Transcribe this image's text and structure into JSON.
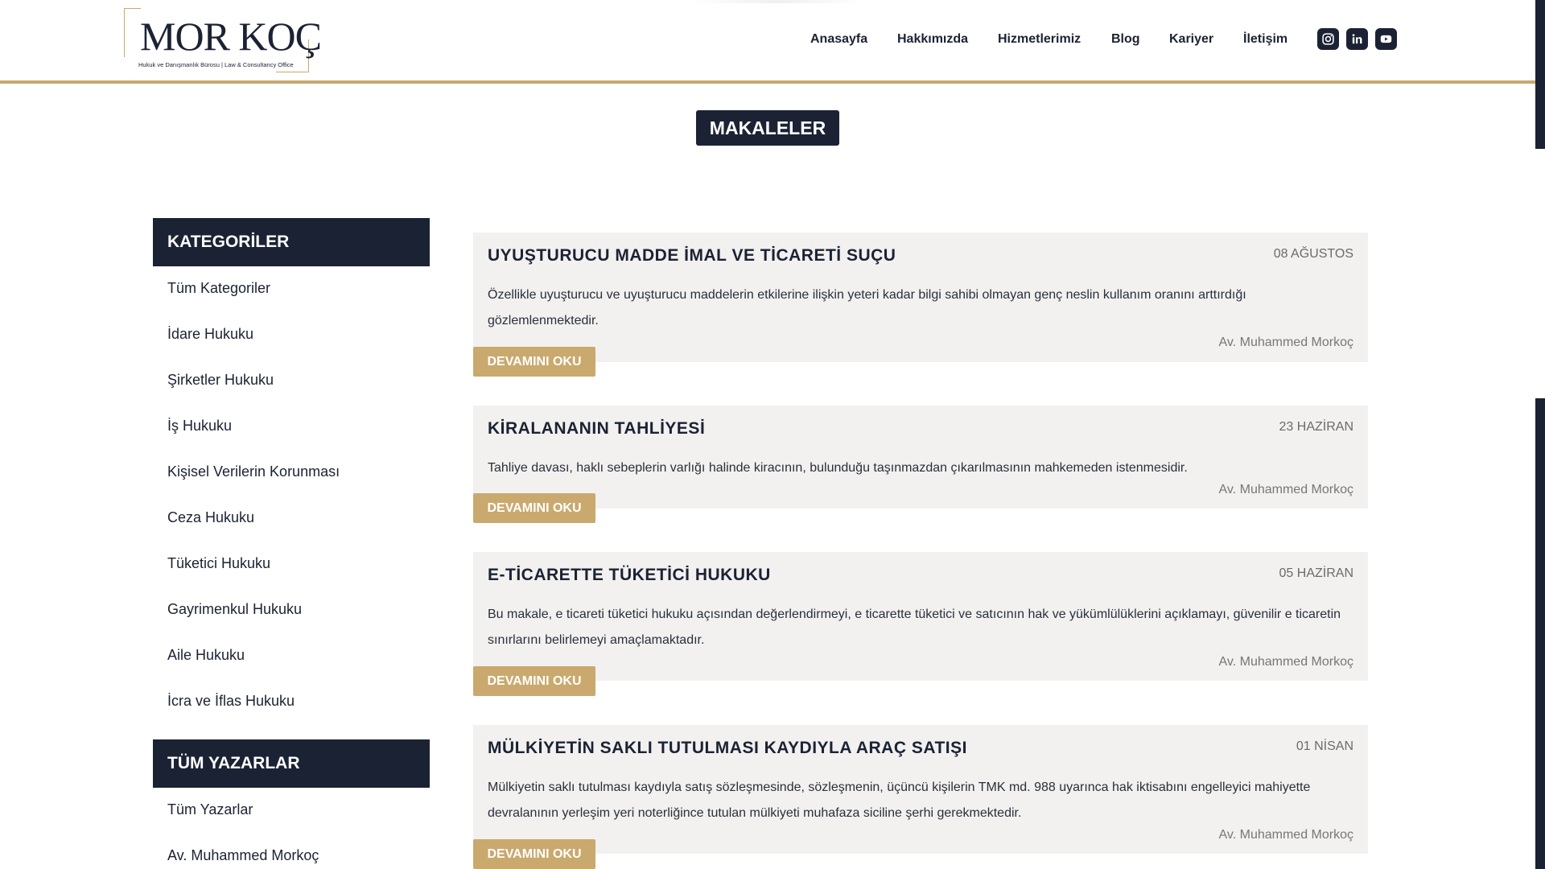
{
  "brand": {
    "name": "MOR KOÇ",
    "tagline": "Hukuk ve Danışmanlık Bürosu | Law & Consultancy Office"
  },
  "nav": {
    "items": [
      "Anasayfa",
      "Hakkımızda",
      "Hizmetlerimiz",
      "Blog",
      "Kariyer",
      "İletişim"
    ],
    "social": [
      "instagram-icon",
      "linkedin-icon",
      "youtube-icon"
    ]
  },
  "page": {
    "title": "MAKALELER"
  },
  "sidebar": {
    "categories_heading": "KATEGORİLER",
    "categories": [
      "Tüm Kategoriler",
      "İdare Hukuku",
      "Şirketler Hukuku",
      "İş Hukuku",
      "Kişisel Verilerin Korunması",
      "Ceza Hukuku",
      "Tüketici Hukuku",
      "Gayrimenkul Hukuku",
      "Aile Hukuku",
      "İcra ve İflas Hukuku"
    ],
    "authors_heading": "TÜM YAZARLAR",
    "authors": [
      "Tüm Yazarlar",
      "Av. Muhammed Morkoç"
    ]
  },
  "articles": [
    {
      "title": "UYUŞTURUCU MADDE İMAL VE TİCARETİ SUÇU",
      "date": "08 AĞUSTOS",
      "excerpt": "Özellikle uyuşturucu ve uyuşturucu maddelerin etkilerine ilişkin yeteri kadar bilgi sahibi olmayan genç neslin kullanım oranını arttırdığı gözlemlenmektedir.",
      "author": "Av. Muhammed Morkoç",
      "read_more": "DEVAMINI OKU"
    },
    {
      "title": "KİRALANANIN TAHLİYESİ",
      "date": "23 HAZİRAN",
      "excerpt": "Tahliye davası, haklı sebeplerin varlığı halinde kiracının, bulunduğu taşınmazdan çıkarılmasının mahkemeden istenmesidir.",
      "author": "Av. Muhammed Morkoç",
      "read_more": "DEVAMINI OKU"
    },
    {
      "title": "E-TİCARETTE TÜKETİCİ HUKUKU",
      "date": "05 HAZİRAN",
      "excerpt": "Bu makale, e ticareti tüketici hukuku açısından değerlendirmeyi, e ticarette tüketici ve satıcının hak ve yükümlülüklerini açıklamayı, güvenilir e ticaretin sınırlarını belirlemeyi amaçlamaktadır.",
      "author": "Av. Muhammed Morkoç",
      "read_more": "DEVAMINI OKU"
    },
    {
      "title": "MÜLKİYETİN SAKLI TUTULMASI KAYDIYLA ARAÇ SATIŞI",
      "date": "01 NİSAN",
      "excerpt": "Mülkiyetin saklı tutulması kaydıyla satış sözleşmesinde, sözleşmenin, üçüncü kişilerin TMK md. 988 uyarınca hak iktisabını engelleyici mahiyette devralanının yerleşim yeri noterliğince tutulan mülkiyeti muhafaza siciline şerhi gerekmektedir.",
      "author": "Av. Muhammed Morkoç",
      "read_more": "DEVAMINI OKU"
    }
  ],
  "colors": {
    "navy": "#1b2233",
    "gold": "#c9a96e",
    "card_bg": "#f2f1f0"
  }
}
